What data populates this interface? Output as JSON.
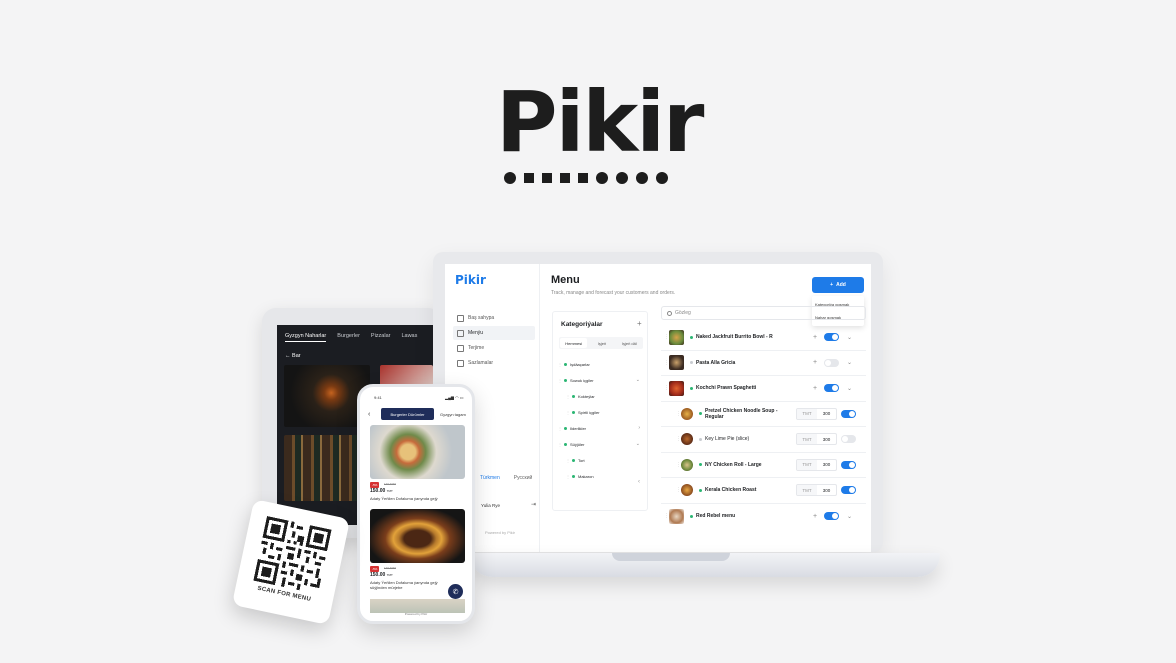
{
  "hero": {
    "logo_text": "Pikir"
  },
  "admin": {
    "logo": "Pikir",
    "nav": [
      {
        "label": "Baş sahypa",
        "icon": "home-icon"
      },
      {
        "label": "Menýu",
        "icon": "menu-icon"
      },
      {
        "label": "Terjime",
        "icon": "translate-icon"
      },
      {
        "label": "Sazlamalar",
        "icon": "settings-icon"
      }
    ],
    "languages": [
      "Türkmen",
      "Русский"
    ],
    "user_name": "Yulia Rye",
    "powered_by": "Powered by Pikir",
    "page_title": "Menu",
    "page_subtitle": "Track, manage and forecast your customers and orders.",
    "add_button": "Add",
    "add_menu": [
      "Kategoriýa goşmak",
      "Nahar goşmak"
    ],
    "categories": {
      "title": "Kategoriýalar",
      "tabs": [
        "Hemmesi",
        "Işjeň",
        "Işjeň däl"
      ],
      "items": [
        {
          "label": "Işdäaçarlar",
          "level": 0,
          "chevron": ""
        },
        {
          "label": "Sowuk içgiler",
          "level": 0,
          "chevron": "down"
        },
        {
          "label": "Kokteýlar",
          "level": 1,
          "chevron": ""
        },
        {
          "label": "Spirtli içgiler",
          "level": 1,
          "chevron": ""
        },
        {
          "label": "Ilderlikler",
          "level": 0,
          "chevron": "right"
        },
        {
          "label": "Süýjüler",
          "level": 0,
          "chevron": "down"
        },
        {
          "label": "Tort",
          "level": 1,
          "chevron": ""
        },
        {
          "label": "Makaron",
          "level": 1,
          "chevron": ""
        }
      ]
    },
    "search_placeholder": "Gözleg",
    "currency": "TMT",
    "items": [
      {
        "name": "Naked Jackfruit Burrito Bowl - R",
        "active": true,
        "sub": false,
        "price": ""
      },
      {
        "name": "Pasta Alla Gricia",
        "active": false,
        "sub": false,
        "price": ""
      },
      {
        "name": "Kochchi Prawn Spaghetti",
        "active": true,
        "sub": false,
        "price": ""
      },
      {
        "name": "Pretzel Chicken Noodle Soup - Regular",
        "active": true,
        "sub": true,
        "price": "300"
      },
      {
        "name": "Key Lime Pie (slice)",
        "active": false,
        "sub": true,
        "price": "300"
      },
      {
        "name": "NY Chicken Roll - Large",
        "active": true,
        "sub": true,
        "price": "300"
      },
      {
        "name": "Kerala Chicken Roast",
        "active": true,
        "sub": true,
        "price": "300"
      },
      {
        "name": "Red Rebel menu",
        "active": true,
        "sub": false,
        "price": ""
      }
    ]
  },
  "tablet": {
    "tabs": [
      "Gyzgyn Naharlar",
      "Burgerler",
      "Pizzalar",
      "Lawas"
    ],
    "back_label": "Bar"
  },
  "phone": {
    "time": "9:41",
    "tab_active": "Burgerler Dürümler",
    "tab_other": "Gyzgyn tagam",
    "products": [
      {
        "badge": "-5%",
        "old_price": "170 TMT",
        "price": "150.00",
        "currency": "TMT",
        "desc": "Adaty Ýeňilen Dofaluma ýanynda gejý"
      },
      {
        "badge": "-5%",
        "old_price": "170 TMT",
        "price": "150.00",
        "currency": "TMT",
        "desc": "Adaty Ýeňilen Dofaluma ýanynda gejý süýjinden mürjebe"
      }
    ],
    "powered_by": "Powered by Pikir"
  },
  "qr_card": {
    "caption": "SCAN FOR MENU"
  },
  "colors": {
    "accent": "#1e7be8",
    "active_dot": "#2bb673",
    "dark_navy": "#1f2d5a"
  }
}
